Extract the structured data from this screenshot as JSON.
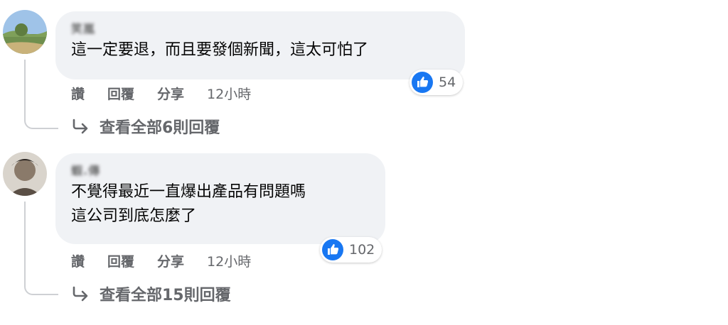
{
  "comments": [
    {
      "author": "笑嵐",
      "text": "這一定要退，而且要發個新聞，這太可怕了",
      "reaction_count": "54",
      "actions": {
        "like": "讚",
        "reply": "回覆",
        "share": "分享",
        "time": "12小時"
      },
      "view_replies": "查看全部6則回覆"
    },
    {
      "author": "蝦.傳",
      "text": "不覺得最近一直爆出產品有問題嗎\n這公司到底怎麼了",
      "reaction_count": "102",
      "actions": {
        "like": "讚",
        "reply": "回覆",
        "share": "分享",
        "time": "12小時"
      },
      "view_replies": "查看全部15則回覆"
    }
  ],
  "colors": {
    "like_blue": "#1877f2",
    "bubble_bg": "#f0f2f5",
    "meta_text": "#65676b"
  }
}
